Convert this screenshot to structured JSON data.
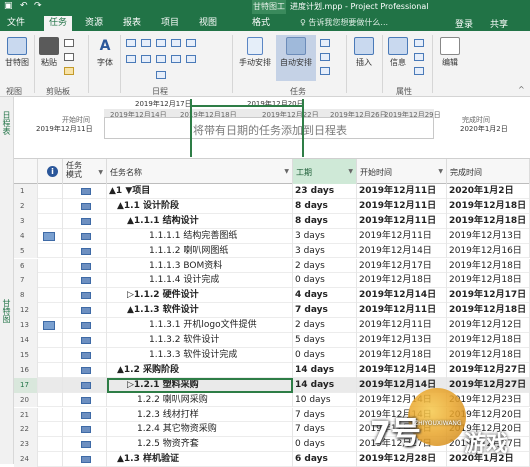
{
  "app": {
    "context_tab": "甘特图工具",
    "title": "进度计划.mpp - Project Professional"
  },
  "tabs": [
    {
      "label": "文件"
    },
    {
      "label": "任务"
    },
    {
      "label": "资源"
    },
    {
      "label": "报表"
    },
    {
      "label": "项目"
    },
    {
      "label": "视图"
    },
    {
      "label": "格式"
    }
  ],
  "tell_me": "告诉我您想要做什么...",
  "login": "登录",
  "share": "共享",
  "ribbon": {
    "gantt_chart": "甘特图",
    "paste": "粘贴",
    "font": "字体",
    "manual": "手动安排",
    "auto": "自动安排",
    "insert": "插入",
    "info": "信息",
    "edit": "编辑",
    "groups": {
      "view": "视图",
      "clipboard": "剪贴板",
      "schedule": "日程",
      "tasks": "任务",
      "properties": "属性"
    }
  },
  "timeline": {
    "side_label": "日程表",
    "start_label": "开始时间",
    "start_date": "2019年12月11日",
    "finish_label": "完成时间",
    "finish_date": "2020年1月2日",
    "upper_dates": [
      "2019年12月17日",
      "2019年12月20日"
    ],
    "scale_dates": [
      "2019年12月14日",
      "2019年12月18日",
      "2019年12月22日",
      "2019年12月26日",
      "2019年12月29日"
    ],
    "message": "将带有日期的任务添加到日程表"
  },
  "grid": {
    "side_label": "甘特图",
    "columns": {
      "info": "i",
      "mode": "任务模式",
      "name": "任务名称",
      "duration": "工期",
      "start": "开始时间",
      "finish": "完成时间"
    },
    "rows": [
      {
        "id": "1",
        "name": "▲1 ▼项目",
        "dur": "23 days",
        "start": "2019年12月11日",
        "finish": "2020年1月2日",
        "bold": true,
        "indent": 0
      },
      {
        "id": "2",
        "name": "▲1.1 设计阶段",
        "dur": "8 days",
        "start": "2019年12月11日",
        "finish": "2019年12月18日",
        "bold": true,
        "indent": 1
      },
      {
        "id": "3",
        "name": "▲1.1.1 结构设计",
        "dur": "8 days",
        "start": "2019年12月11日",
        "finish": "2019年12月18日",
        "bold": true,
        "indent": 2
      },
      {
        "id": "4",
        "name": "1.1.1.1 结构完善图纸",
        "dur": "3 days",
        "start": "2019年12月11日",
        "finish": "2019年12月13日",
        "bold": false,
        "indent": 3,
        "note": true
      },
      {
        "id": "5",
        "name": "1.1.1.2 喇叭网图纸",
        "dur": "3 days",
        "start": "2019年12月14日",
        "finish": "2019年12月16日",
        "bold": false,
        "indent": 3
      },
      {
        "id": "6",
        "name": "1.1.1.3 BOM资料",
        "dur": "2 days",
        "start": "2019年12月17日",
        "finish": "2019年12月18日",
        "bold": false,
        "indent": 3
      },
      {
        "id": "7",
        "name": "1.1.1.4 设计完成",
        "dur": "0 days",
        "start": "2019年12月18日",
        "finish": "2019年12月18日",
        "bold": false,
        "indent": 3
      },
      {
        "id": "8",
        "name": "▷1.1.2 硬件设计",
        "dur": "4 days",
        "start": "2019年12月14日",
        "finish": "2019年12月17日",
        "bold": true,
        "indent": 2
      },
      {
        "id": "12",
        "name": "▲1.1.3 软件设计",
        "dur": "7 days",
        "start": "2019年12月11日",
        "finish": "2019年12月18日",
        "bold": true,
        "indent": 2
      },
      {
        "id": "13",
        "name": "1.1.3.1 开机logo文件提供",
        "dur": "2 days",
        "start": "2019年12月11日",
        "finish": "2019年12月12日",
        "bold": false,
        "indent": 3,
        "note": true
      },
      {
        "id": "14",
        "name": "1.1.3.2 软件设计",
        "dur": "5 days",
        "start": "2019年12月13日",
        "finish": "2019年12月18日",
        "bold": false,
        "indent": 3
      },
      {
        "id": "15",
        "name": "1.1.3.3 软件设计完成",
        "dur": "0 days",
        "start": "2019年12月18日",
        "finish": "2019年12月18日",
        "bold": false,
        "indent": 3
      },
      {
        "id": "16",
        "name": "▲1.2 采购阶段",
        "dur": "14 days",
        "start": "2019年12月14日",
        "finish": "2019年12月27日",
        "bold": true,
        "indent": 1
      },
      {
        "id": "17",
        "name": "▷1.2.1 塑料采购",
        "dur": "14 days",
        "start": "2019年12月14日",
        "finish": "2019年12月27日",
        "bold": true,
        "indent": 2,
        "selected": true
      },
      {
        "id": "20",
        "name": "1.2.2 喇叭网采购",
        "dur": "10 days",
        "start": "2019年12月14日",
        "finish": "2019年12月23日",
        "bold": false,
        "indent": 2
      },
      {
        "id": "21",
        "name": "1.2.3 线材打样",
        "dur": "7 days",
        "start": "2019年12月14日",
        "finish": "2019年12月20日",
        "bold": false,
        "indent": 2
      },
      {
        "id": "22",
        "name": "1.2.4 其它物资采购",
        "dur": "7 days",
        "start": "2019年12月14日",
        "finish": "2019年12月20日",
        "bold": false,
        "indent": 2
      },
      {
        "id": "23",
        "name": "1.2.5 物资齐套",
        "dur": "0 days",
        "start": "2019年12月27日",
        "finish": "2019年12月27日",
        "bold": false,
        "indent": 2
      },
      {
        "id": "24",
        "name": "▲1.3 样机验证",
        "dur": "6 days",
        "start": "2019年12月28日",
        "finish": "2020年1月2日",
        "bold": true,
        "indent": 1
      }
    ]
  },
  "watermark": {
    "big": "7号",
    "small": "游戏",
    "sub": "ZHIYOUXIWANG"
  },
  "colors": {
    "accent": "#217346",
    "duration_header": "#cfe9d7",
    "selection_outline": "#2e7d46"
  }
}
